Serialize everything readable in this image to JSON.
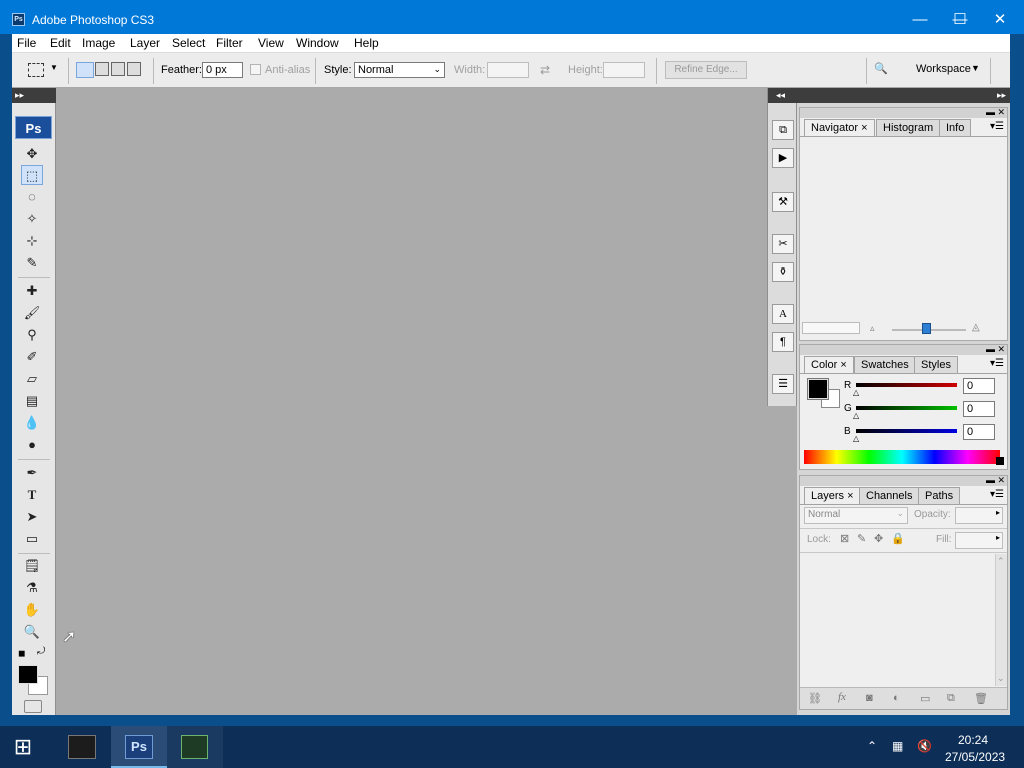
{
  "window": {
    "title": "Adobe Photoshop CS3",
    "app_icon_text": "Ps",
    "minimize": "—",
    "maximize": "☐",
    "close": "✕"
  },
  "menu": [
    "File",
    "Edit",
    "Image",
    "Layer",
    "Select",
    "Filter",
    "View",
    "Window",
    "Help"
  ],
  "options": {
    "feather_label": "Feather:",
    "feather_value": "0 px",
    "antialias_label": "Anti-alias",
    "style_label": "Style:",
    "style_value": "Normal",
    "width_label": "Width:",
    "height_label": "Height:",
    "refine_edge": "Refine Edge...",
    "workspace": "Workspace"
  },
  "toolbox": {
    "logo": "Ps"
  },
  "navigator_panel": {
    "tabs": [
      "Navigator",
      "Histogram",
      "Info"
    ]
  },
  "color_panel": {
    "tabs": [
      "Color",
      "Swatches",
      "Styles"
    ],
    "channels": [
      {
        "label": "R",
        "value": "0",
        "color": "#c00000"
      },
      {
        "label": "G",
        "value": "0",
        "color": "#00b000"
      },
      {
        "label": "B",
        "value": "0",
        "color": "#0000d0"
      }
    ]
  },
  "layers_panel": {
    "tabs": [
      "Layers",
      "Channels",
      "Paths"
    ],
    "blend_mode": "Normal",
    "opacity_label": "Opacity:",
    "lock_label": "Lock:",
    "fill_label": "Fill:"
  },
  "taskbar": {
    "time": "20:24",
    "date": "27/05/2023"
  },
  "colors": {
    "accent": "#0078d7",
    "workspace": "#ababab"
  }
}
